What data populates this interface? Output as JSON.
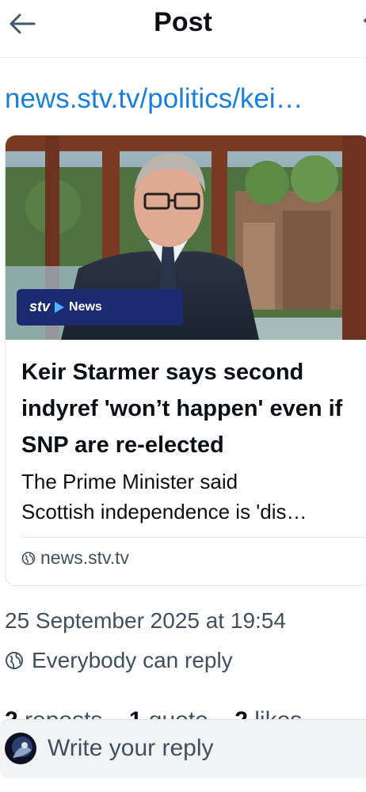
{
  "header": {
    "title": "Post",
    "back_icon": "arrow-left-icon"
  },
  "post": {
    "link_text": "news.stv.tv/politics/kei…",
    "card": {
      "image_logo_brand": "stv",
      "image_logo_text": "News",
      "title": "Keir Starmer says second indyref 'won’t happen' even if SNP are re-elected",
      "description_line1": "The Prime Minister said",
      "description_line2": "Scottish independence is 'dis…",
      "domain": "news.stv.tv",
      "domain_icon": "globe-icon"
    },
    "timestamp": "25 September 2025 at 19:54",
    "reply_permission": "Everybody can reply",
    "reply_permission_icon": "globe-icon",
    "stats": {
      "reposts_count": "2",
      "reposts_label": "reposts",
      "quotes_count": "1",
      "quotes_label": "quote",
      "likes_count": "2",
      "likes_label": "likes"
    }
  },
  "composer": {
    "placeholder": "Write your reply"
  },
  "colors": {
    "link": "#1a7fdc",
    "muted": "#414f5e",
    "text": "#0b0f14",
    "stv_banner": "#1c2a72"
  }
}
